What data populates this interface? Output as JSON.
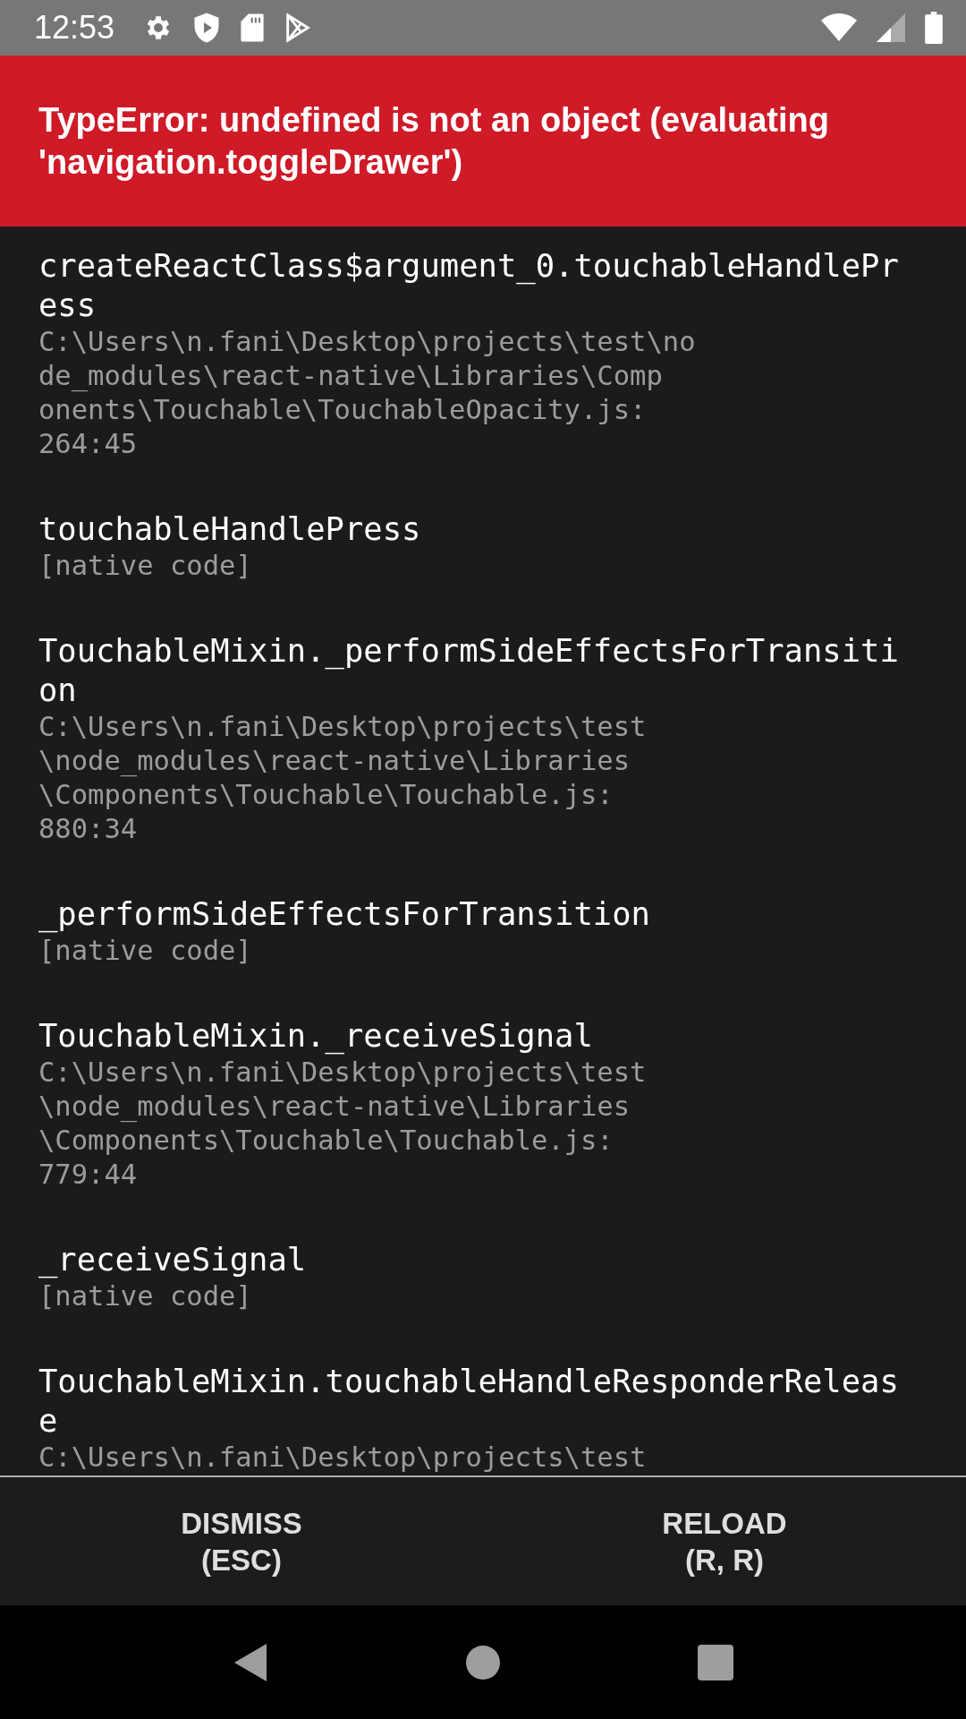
{
  "status_bar": {
    "time": "12:53"
  },
  "error": {
    "title": "TypeError: undefined is not an object (evaluating 'navigation.toggleDrawer')"
  },
  "stack_frames": [
    {
      "method_lines": [
        "createReactClass$argument_0.touchableHandlePr",
        "ess"
      ],
      "location_lines": [
        "C:\\Users\\n.fani\\Desktop\\projects\\test\\no",
        "de_modules\\react-native\\Libraries\\Comp",
        "onents\\Touchable\\TouchableOpacity.js:",
        "264:45"
      ]
    },
    {
      "method_lines": [
        "touchableHandlePress"
      ],
      "location_lines": [
        "[native code]"
      ]
    },
    {
      "method_lines": [
        "TouchableMixin._performSideEffectsForTransiti",
        "on"
      ],
      "location_lines": [
        "C:\\Users\\n.fani\\Desktop\\projects\\test",
        "\\node_modules\\react-native\\Libraries",
        "\\Components\\Touchable\\Touchable.js:",
        "880:34"
      ]
    },
    {
      "method_lines": [
        "_performSideEffectsForTransition"
      ],
      "location_lines": [
        "[native code]"
      ]
    },
    {
      "method_lines": [
        "TouchableMixin._receiveSignal"
      ],
      "location_lines": [
        "C:\\Users\\n.fani\\Desktop\\projects\\test",
        "\\node_modules\\react-native\\Libraries",
        "\\Components\\Touchable\\Touchable.js:",
        "779:44"
      ]
    },
    {
      "method_lines": [
        "_receiveSignal"
      ],
      "location_lines": [
        "[native code]"
      ]
    },
    {
      "method_lines": [
        "TouchableMixin.touchableHandleResponderReleas",
        "e"
      ],
      "location_lines": [
        "C:\\Users\\n.fani\\Desktop\\projects\\test"
      ]
    }
  ],
  "buttons": [
    {
      "lines": [
        "DISMISS",
        "(ESC)"
      ]
    },
    {
      "lines": [
        "RELOAD",
        "(R, R)"
      ]
    }
  ]
}
